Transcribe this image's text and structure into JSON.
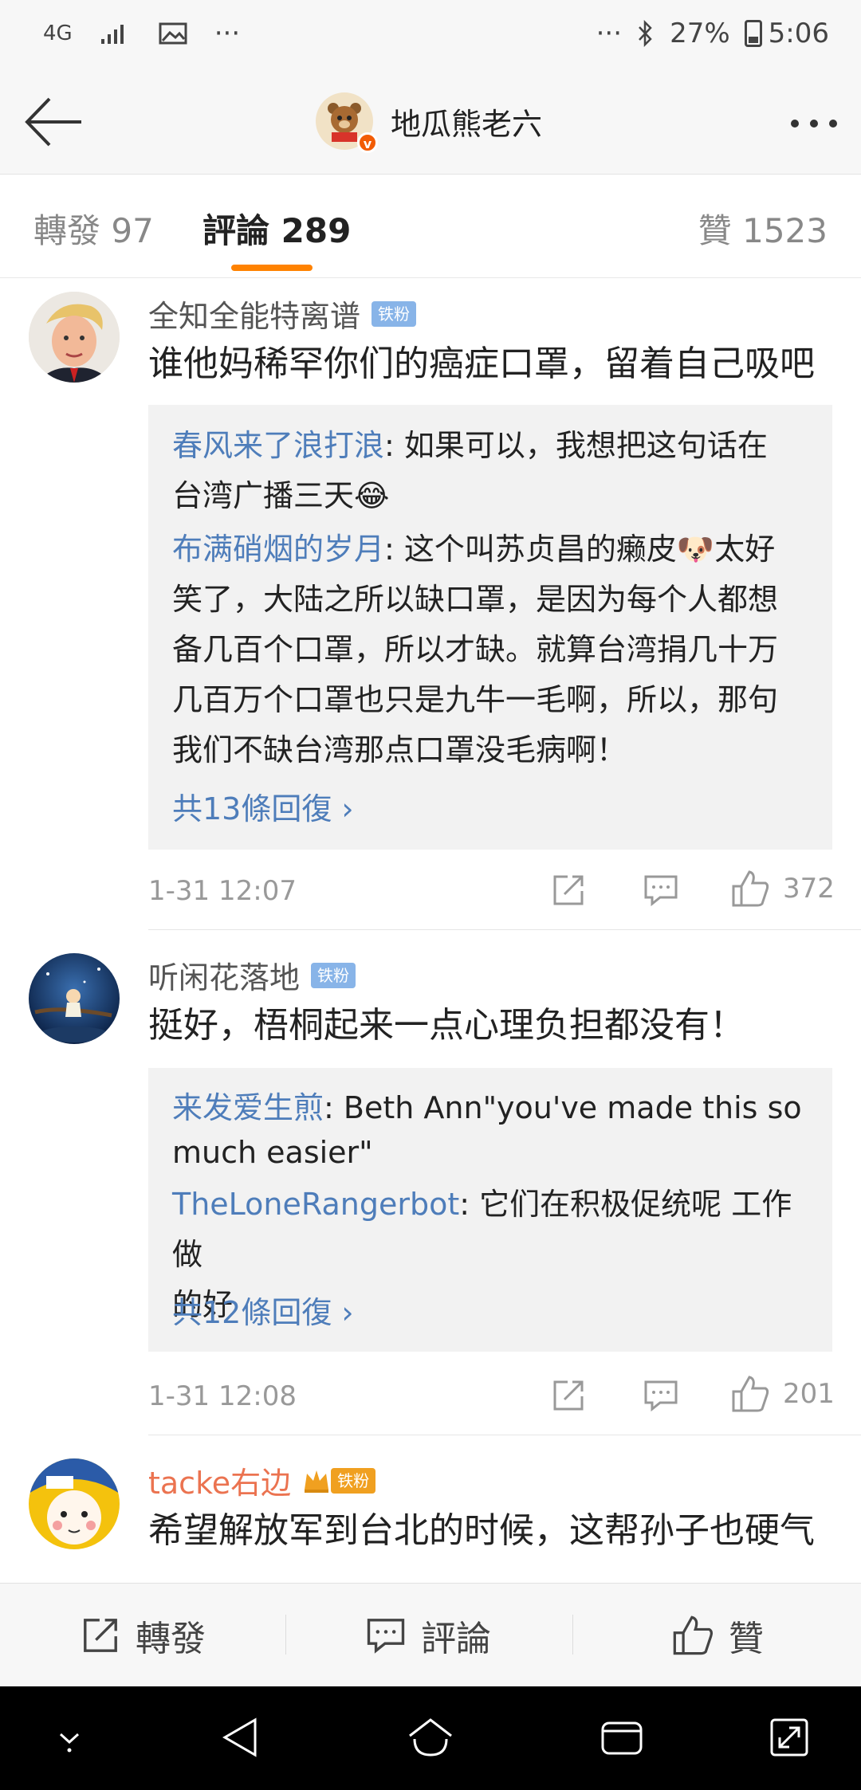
{
  "status_bar": {
    "network": "4G",
    "dots_left": "···",
    "dots_right": "···",
    "battery": "27%",
    "time": "5:06"
  },
  "header": {
    "title": "地瓜熊老六"
  },
  "tabs": [
    {
      "label": "轉發 97",
      "active": false
    },
    {
      "label": "評論 289",
      "active": true
    },
    {
      "label": "贊 1523",
      "active": false
    }
  ],
  "comments": [
    {
      "user": "全知全能特离谱",
      "badge": "铁粉",
      "text": "谁他妈稀罕你们的癌症口罩，留着自己吸吧",
      "replies": [
        {
          "user": "春风来了浪打浪",
          "text": ": 如果可以，我想把这句话在",
          "text2": "台湾广播三天",
          "emoji": "😂"
        },
        {
          "user": "布满硝烟的岁月",
          "text": ": 这个叫苏贞昌的癞皮",
          "emoji": "🐶",
          "text_after": "太好",
          "lines": [
            "笑了，大陆之所以缺口罩，是因为每个人都想",
            "备几百个口罩，所以才缺。就算台湾捐几十万",
            "几百万个口罩也只是九牛一毛啊，所以，那句",
            "我们不缺台湾那点口罩没毛病啊！"
          ]
        }
      ],
      "more_replies": "共13條回復 ›",
      "time": "1-31 12:07",
      "likes": "372"
    },
    {
      "user": "听闲花落地",
      "badge": "铁粉",
      "text": "挺好，梧桐起来一点心理负担都没有！",
      "replies": [
        {
          "user": "来发爱生煎",
          "text": ": Beth Ann\"you've made this so",
          "text2": "much easier\""
        },
        {
          "user": "TheLoneRangerbot",
          "text": ": 它们在积极促统呢 工作做",
          "text2": "的好"
        }
      ],
      "more_replies": "共12條回復 ›",
      "time": "1-31 12:08",
      "likes": "201"
    },
    {
      "user": "tacke右边",
      "badge": "铁粉",
      "text": "希望解放军到台北的时候，这帮孙子也硬气"
    }
  ],
  "bottom_bar": {
    "repost": "轉發",
    "comment": "評論",
    "like": "贊"
  },
  "colors": {
    "accent": "#ff8200",
    "link": "#4e7dba",
    "fan_badge": "#88b4e8",
    "orange_name": "#eb7350"
  }
}
